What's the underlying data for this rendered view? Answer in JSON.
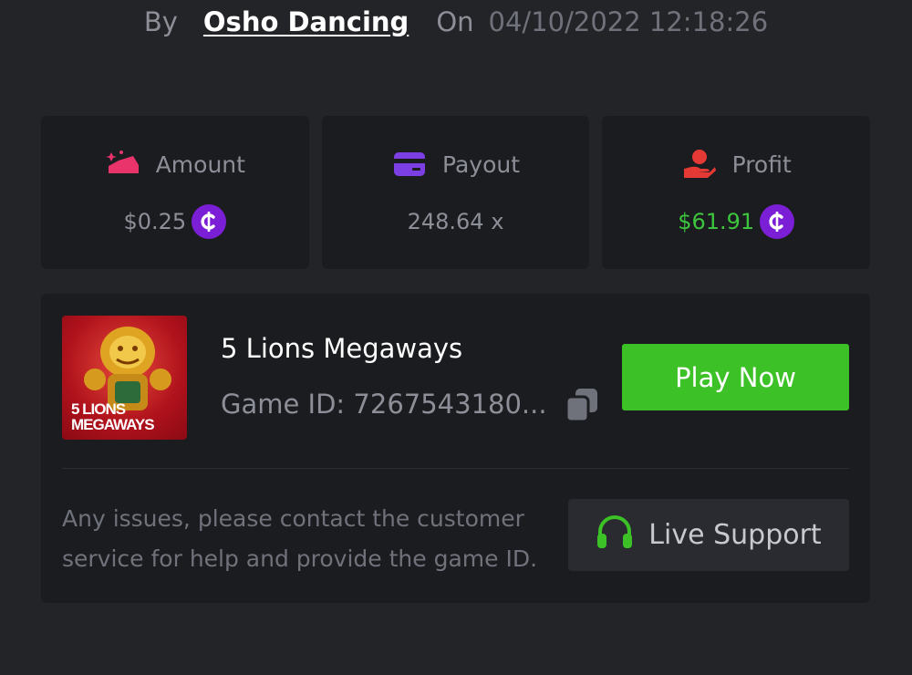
{
  "bet": {
    "by_label": "By",
    "username": "Osho Dancing",
    "on_label": "On",
    "datetime": "04/10/2022 12:18:26"
  },
  "stats": {
    "amount": {
      "label": "Amount",
      "value": "$0.25",
      "icon": "wallet-coins-icon",
      "color": "#e8336b"
    },
    "payout": {
      "label": "Payout",
      "value": "248.64 x",
      "icon": "credit-card-icon",
      "color": "#7b3fe4"
    },
    "profit": {
      "label": "Profit",
      "value": "$61.91",
      "icon": "hand-coin-icon",
      "color": "#e53935",
      "value_color": "#3dc53d"
    }
  },
  "currency": {
    "icon": "coin-icon",
    "symbol": "₵",
    "color": "#7b1fd6"
  },
  "game": {
    "thumbnail_text_line1": "5 LIONS",
    "thumbnail_text_line2": "MEGAWAYS",
    "title": "5 Lions Megaways",
    "id_label": "Game ID: 7267543180...",
    "play_label": "Play Now",
    "play_color": "#3cc126"
  },
  "support": {
    "help_text": "Any issues, please contact the customer service for help and provide the game ID.",
    "button_label": "Live Support",
    "icon": "headset-icon",
    "icon_color": "#3cc126"
  }
}
